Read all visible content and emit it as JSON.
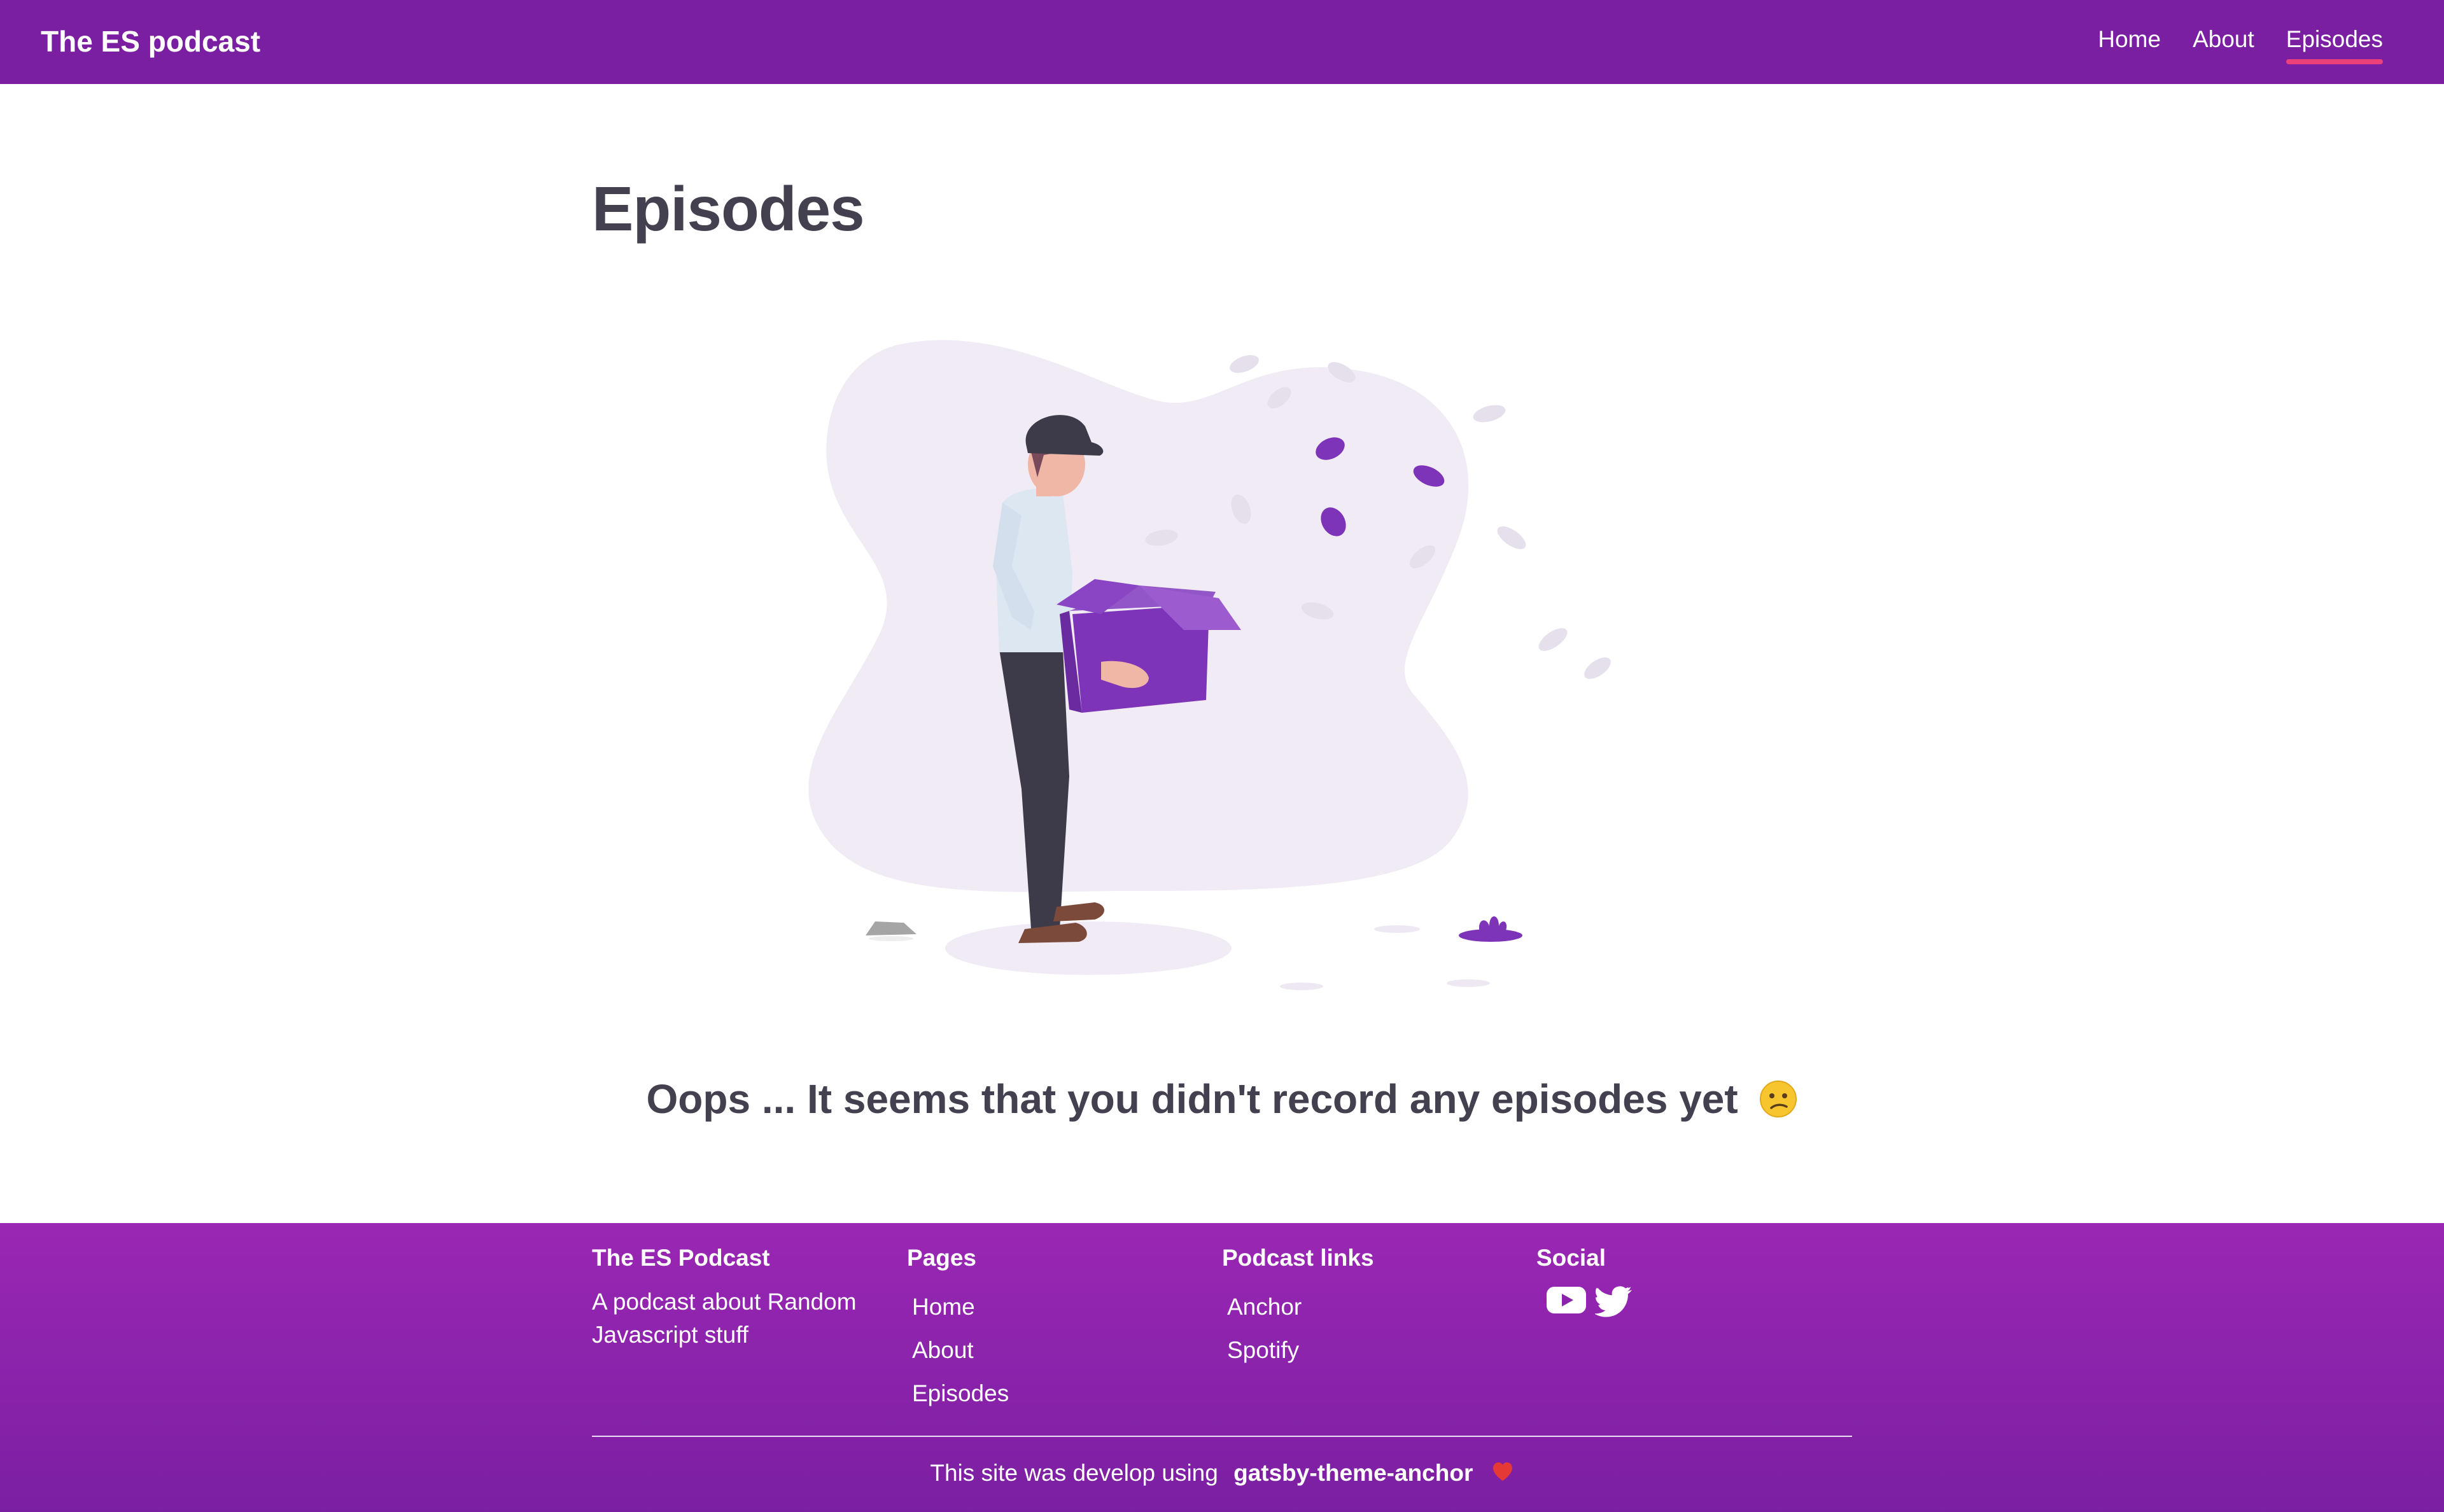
{
  "header": {
    "brand": "The ES podcast",
    "nav": [
      {
        "label": "Home"
      },
      {
        "label": "About"
      },
      {
        "label": "Episodes"
      }
    ]
  },
  "main": {
    "title": "Episodes",
    "empty_message": "Oops ... It seems that you didn't record any episodes yet",
    "emoji": "confused-face-icon"
  },
  "footer": {
    "about": {
      "heading": "The ES Podcast",
      "text": "A podcast about Random Javascript stuff"
    },
    "pages": {
      "heading": "Pages",
      "links": [
        "Home",
        "About",
        "Episodes"
      ]
    },
    "podcast_links": {
      "heading": "Podcast links",
      "links": [
        "Anchor",
        "Spotify"
      ]
    },
    "social": {
      "heading": "Social",
      "icons": [
        "youtube-icon",
        "twitter-icon"
      ]
    },
    "credit_prefix": "This site was develop using",
    "credit_name": "gatsby-theme-anchor",
    "credit_icon": "heart-icon"
  },
  "colors": {
    "header_bg": "#7b1fa2",
    "active_underline": "#ec407a",
    "text_dark": "#45404f",
    "accent_purple": "#7e34b8"
  }
}
